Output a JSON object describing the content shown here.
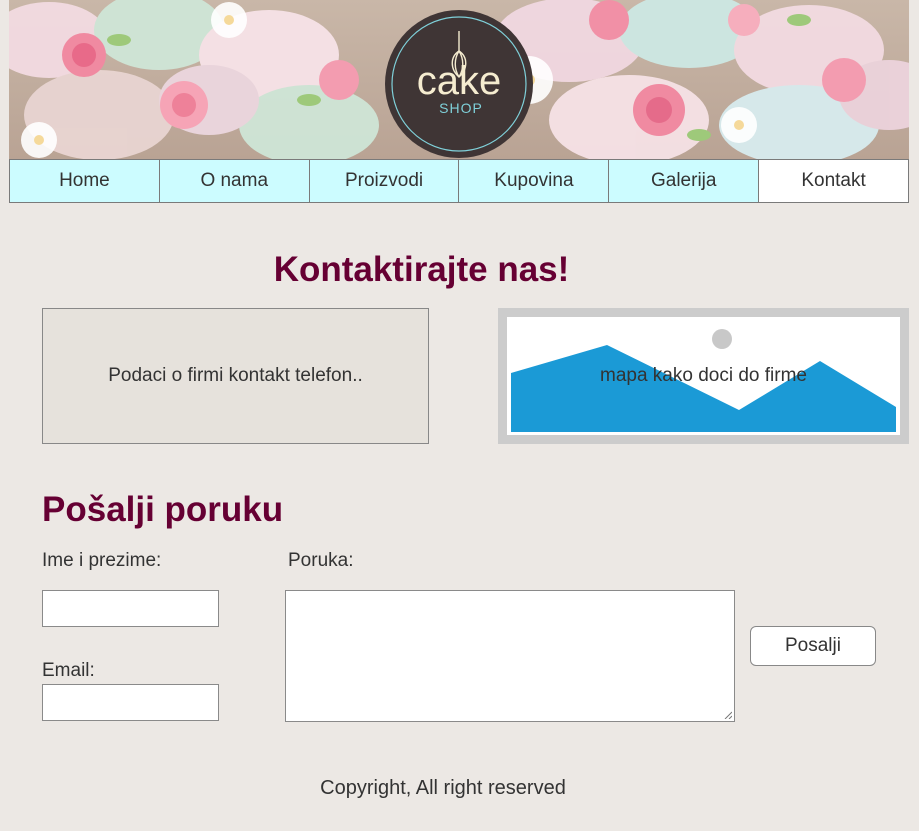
{
  "header": {
    "logo_text": "cake",
    "logo_subtext": "SHOP"
  },
  "nav": {
    "items": [
      {
        "label": "Home"
      },
      {
        "label": "O nama"
      },
      {
        "label": "Proizvodi"
      },
      {
        "label": "Kupovina"
      },
      {
        "label": "Galerija"
      },
      {
        "label": "Kontakt",
        "active": true
      }
    ]
  },
  "contact": {
    "title": "Kontaktirajte nas!",
    "info_text": "Podaci o firmi kontakt telefon..",
    "map_text": "mapa kako doci do firme"
  },
  "form": {
    "title": "Pošalji poruku",
    "name_label": "Ime i prezime:",
    "name_value": "",
    "email_label": "Email:",
    "email_value": "",
    "message_label": "Poruka:",
    "message_value": "",
    "submit_label": "Posalji"
  },
  "footer": {
    "text": "Copyright, All right reserved"
  },
  "colors": {
    "background": "#ece8e4",
    "nav_bg": "#ccfcff",
    "heading": "#660033",
    "map_blue": "#1b9ad6",
    "logo_dark": "#3f3535",
    "logo_cream": "#f5ecd0",
    "logo_teal": "#7fd0d9"
  }
}
